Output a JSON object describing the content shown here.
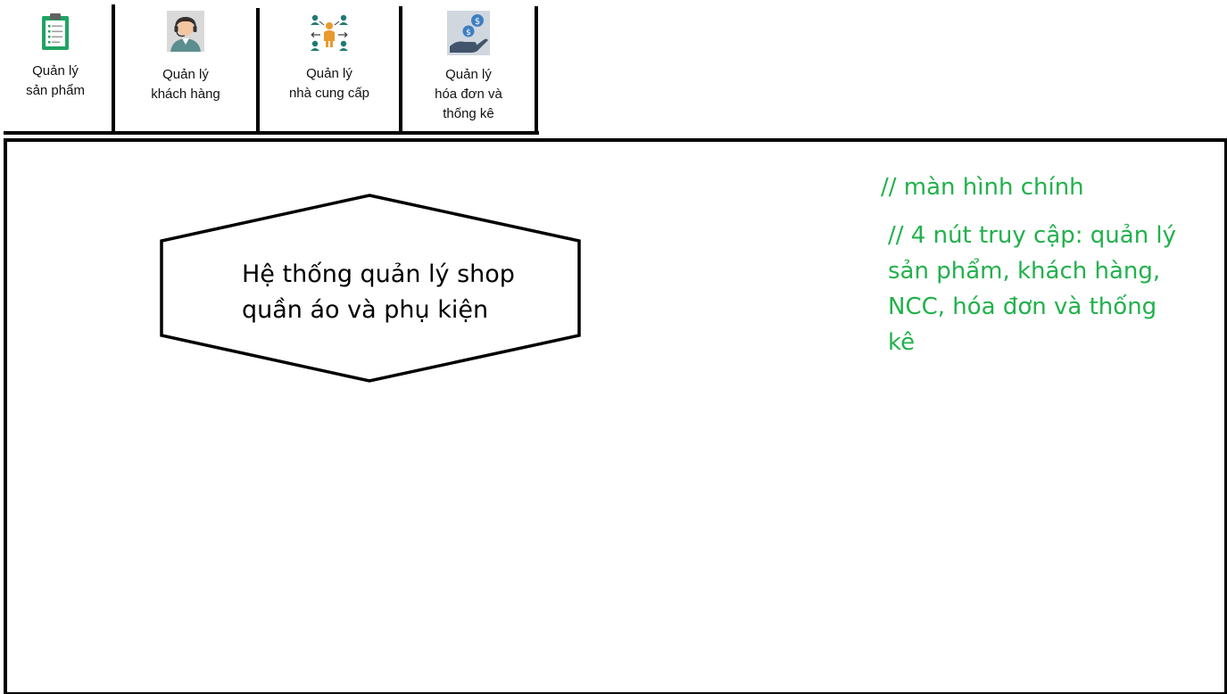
{
  "toolbar": {
    "buttons": [
      {
        "icon": "clipboard-icon",
        "label_lines": [
          "Quản lý",
          "sản phẩm"
        ]
      },
      {
        "icon": "customer-support-agent-icon",
        "label_lines": [
          "Quản lý",
          "khách hàng"
        ]
      },
      {
        "icon": "supplier-network-icon",
        "label_lines": [
          "Quản lý",
          "nhà cung cấp"
        ]
      },
      {
        "icon": "money-hand-icon",
        "label_lines": [
          "Quản lý",
          "hóa đơn và",
          "thống kê"
        ]
      }
    ]
  },
  "main": {
    "title_lines": [
      "Hệ thống quản lý shop",
      "quần áo và phụ kiện"
    ],
    "notes": {
      "screen_comment": "// màn hình chính",
      "buttons_comment_lines": [
        "// 4 nút truy cập: quản lý",
        "sản phẩm, khách hàng,",
        "NCC, hóa đơn và thống",
        "kê"
      ]
    }
  },
  "colors": {
    "note_green": "#22b14c",
    "border": "#000000"
  }
}
